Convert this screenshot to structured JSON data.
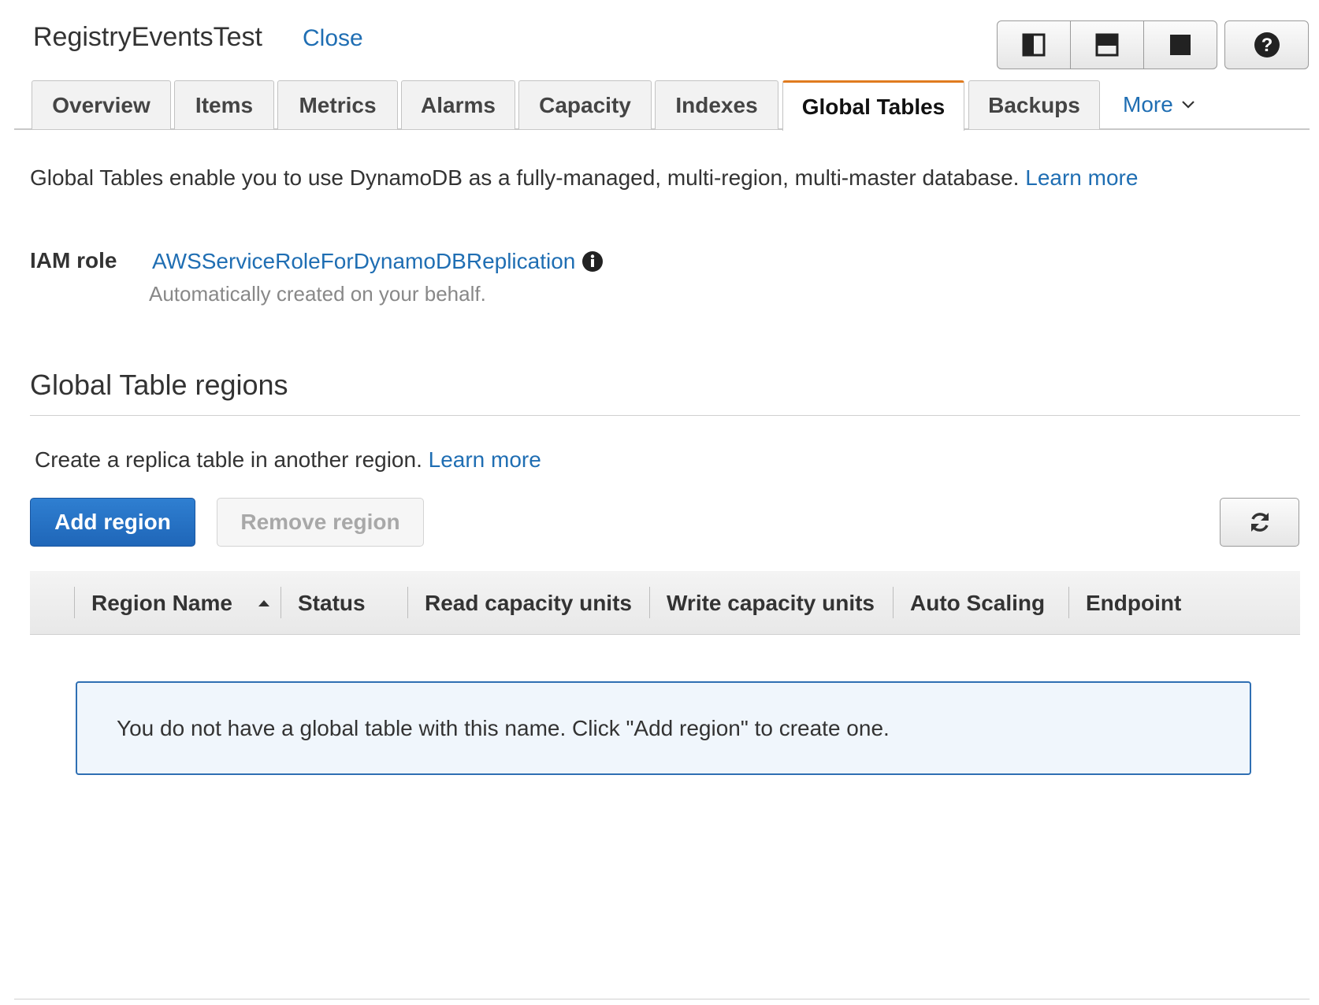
{
  "header": {
    "table_name": "RegistryEventsTest",
    "close_label": "Close"
  },
  "tabs": [
    {
      "label": "Overview"
    },
    {
      "label": "Items"
    },
    {
      "label": "Metrics"
    },
    {
      "label": "Alarms"
    },
    {
      "label": "Capacity"
    },
    {
      "label": "Indexes"
    },
    {
      "label": "Global Tables",
      "active": true
    },
    {
      "label": "Backups"
    }
  ],
  "more_tab": {
    "label": "More"
  },
  "intro": {
    "text": "Global Tables enable you to use DynamoDB as a fully-managed, multi-region, multi-master database.",
    "learn_more": "Learn more"
  },
  "iam": {
    "label": "IAM role",
    "role_name": "AWSServiceRoleForDynamoDBReplication",
    "subtext": "Automatically created on your behalf."
  },
  "regions_section": {
    "title": "Global Table regions",
    "description": "Create a replica table in another region.",
    "learn_more": "Learn more",
    "add_button": "Add region",
    "remove_button": "Remove region"
  },
  "table": {
    "columns": [
      "Region Name",
      "Status",
      "Read capacity units",
      "Write capacity units",
      "Auto Scaling",
      "Endpoint"
    ],
    "empty_message": "You do not have a global table with this name. Click \"Add region\" to create one."
  },
  "icons": {
    "layout_split_vertical": "layout-split-vertical-icon",
    "layout_split_horizontal": "layout-split-horizontal-icon",
    "layout_full": "layout-full-icon",
    "help": "help-icon",
    "info": "info-icon",
    "chevron_down": "chevron-down-icon",
    "sort_ascending": "sort-ascending-icon",
    "refresh": "refresh-icon"
  },
  "colors": {
    "link": "#1f6eb3",
    "active_tab_accent": "#e07b1f",
    "primary_button": "#1f66b8",
    "info_border": "#2f6fb3"
  }
}
